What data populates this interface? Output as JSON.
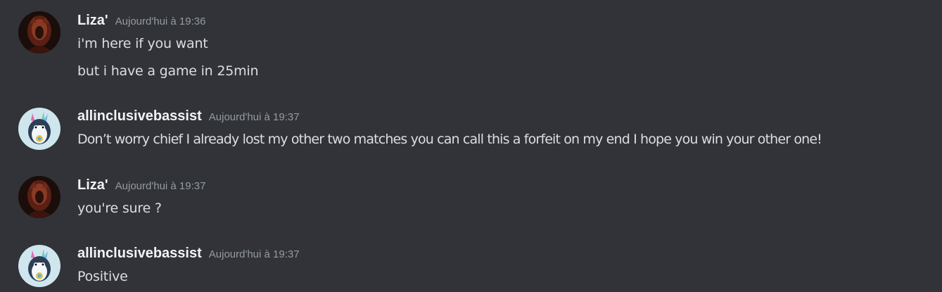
{
  "messages": [
    {
      "username": "Liza'",
      "timestamp": "Aujourd'hui à 19:36",
      "avatar_icon": "dark-red-hooded-figure-avatar",
      "lines": [
        "i'm here if you want",
        "but i have a game in 25min"
      ]
    },
    {
      "username": "allinclusivebassist",
      "timestamp": "Aujourd'hui à 19:37",
      "avatar_icon": "penguin-mascot-avatar",
      "lines": [
        "Don’t worry chief I already lost my other two matches you can call this a forfeit on my end I hope you win your other one!"
      ]
    },
    {
      "username": "Liza'",
      "timestamp": "Aujourd'hui à 19:37",
      "avatar_icon": "dark-red-hooded-figure-avatar",
      "lines": [
        "you're sure ?"
      ]
    },
    {
      "username": "allinclusivebassist",
      "timestamp": "Aujourd'hui à 19:37",
      "avatar_icon": "penguin-mascot-avatar",
      "lines": [
        "Positive"
      ]
    }
  ],
  "colors": {
    "background": "#313338",
    "username": "#f2f3f5",
    "timestamp": "#949ba4",
    "message_text": "#dbdee1"
  }
}
